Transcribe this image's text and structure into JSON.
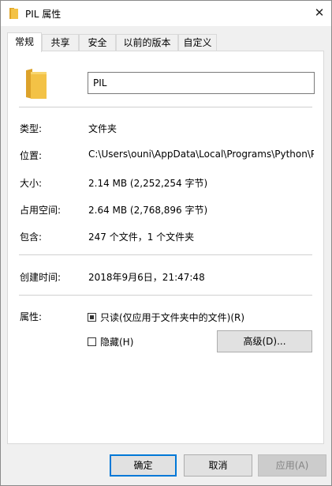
{
  "window": {
    "title": "PIL 属性",
    "close_glyph": "✕"
  },
  "tabs": [
    {
      "label": "常规",
      "active": true
    },
    {
      "label": "共享",
      "active": false
    },
    {
      "label": "安全",
      "active": false
    },
    {
      "label": "以前的版本",
      "active": false
    },
    {
      "label": "自定义",
      "active": false
    }
  ],
  "general": {
    "folder_name": "PIL",
    "type_label": "类型:",
    "type_value": "文件夹",
    "location_label": "位置:",
    "location_value": "C:\\Users\\ouni\\AppData\\Local\\Programs\\Python\\P",
    "size_label": "大小:",
    "size_value": "2.14 MB (2,252,254 字节)",
    "size_on_disk_label": "占用空间:",
    "size_on_disk_value": "2.64 MB (2,768,896 字节)",
    "contains_label": "包含:",
    "contains_value": "247 个文件，1 个文件夹",
    "created_label": "创建时间:",
    "created_value": "2018年9月6日，21:47:48",
    "attributes_label": "属性:",
    "readonly_label": "只读(仅应用于文件夹中的文件)(R)",
    "readonly_state": "indeterminate",
    "hidden_label": "隐藏(H)",
    "hidden_state": "unchecked",
    "advanced_label": "高级(D)..."
  },
  "footer": {
    "ok_label": "确定",
    "cancel_label": "取消",
    "apply_label": "应用(A)"
  },
  "colors": {
    "folder": "#f3c246",
    "accent": "#0078d7"
  }
}
